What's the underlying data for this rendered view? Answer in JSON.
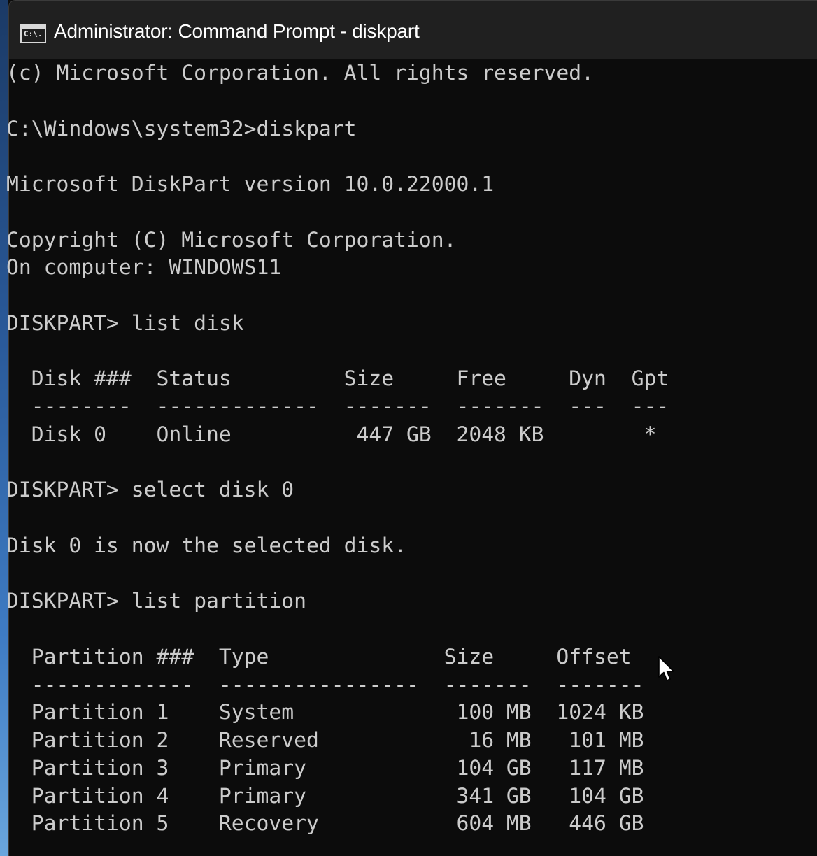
{
  "window": {
    "title": "Administrator: Command Prompt - diskpart",
    "icon": "cmd-icon",
    "icon_glyph": "C:\\."
  },
  "console": {
    "lines": [
      "(c) Microsoft Corporation. All rights reserved.",
      "",
      "C:\\Windows\\system32>diskpart",
      "",
      "Microsoft DiskPart version 10.0.22000.1",
      "",
      "Copyright (C) Microsoft Corporation.",
      "On computer: WINDOWS11",
      "",
      "DISKPART> list disk",
      "",
      "  Disk ###  Status         Size     Free     Dyn  Gpt",
      "  --------  -------------  -------  -------  ---  ---",
      "  Disk 0    Online          447 GB  2048 KB        *",
      "",
      "DISKPART> select disk 0",
      "",
      "Disk 0 is now the selected disk.",
      "",
      "DISKPART> list partition",
      "",
      "  Partition ###  Type              Size     Offset",
      "  -------------  ----------------  -------  -------",
      "  Partition 1    System             100 MB  1024 KB",
      "  Partition 2    Reserved            16 MB   101 MB",
      "  Partition 3    Primary            104 GB   117 MB",
      "  Partition 4    Primary            341 GB   104 GB",
      "  Partition 5    Recovery           604 MB   446 GB"
    ]
  },
  "colors": {
    "console_background": "#0c0c0c",
    "console_text": "#cccccc",
    "titlebar_background": "#202020",
    "title_text": "#ffffff"
  },
  "pointer": "mouse-pointer-icon"
}
